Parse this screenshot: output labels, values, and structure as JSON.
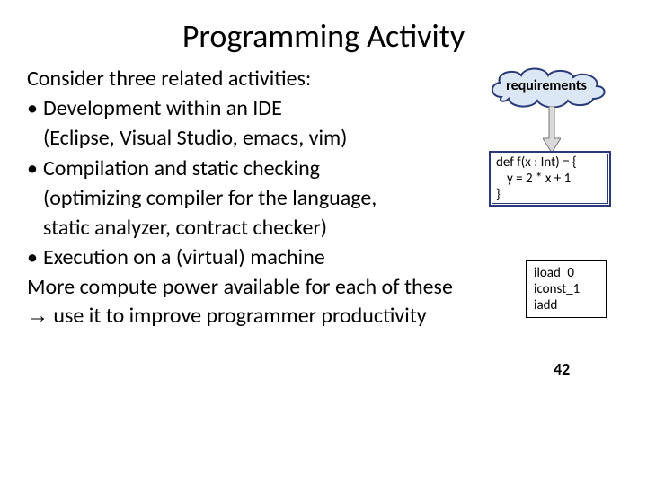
{
  "title": "Programming Activity",
  "cloud_label": "requirements",
  "code": {
    "l1": "def f(x : Int) = {",
    "l2": "y = 2 * x + 1",
    "l3": "}"
  },
  "bytecode": {
    "l1": "iload_0",
    "l2": "iconst_1",
    "l3": "iadd"
  },
  "result": "42",
  "body": {
    "intro": "Consider three related activities:",
    "b1a": "Development within an IDE",
    "b1b": "(Eclipse, Visual Studio, emacs, vim)",
    "b2a": "Compilation and static checking",
    "b2b": "(optimizing compiler for the language,",
    "b2c": "static analyzer, contract checker)",
    "b3": "Execution on a (virtual) machine",
    "close1": "More compute power available for each of these",
    "close2": " use it to improve programmer productivity"
  }
}
